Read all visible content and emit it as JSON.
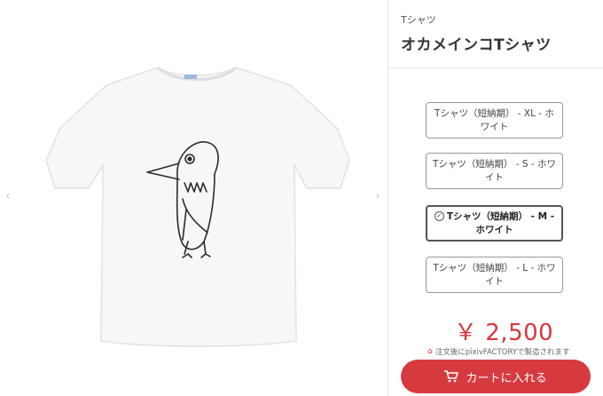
{
  "product": {
    "category": "Tシャツ",
    "title": "オカメインコTシャツ"
  },
  "variants": [
    {
      "label": "Tシャツ（短納期） - XL - ホワイト",
      "selected": false
    },
    {
      "label": "Tシャツ（短納期） - S - ホワイト",
      "selected": false
    },
    {
      "label": "Tシャツ（短納期） - M - ホワイト",
      "selected": true
    },
    {
      "label": "Tシャツ（短納期） - L - ホワイト",
      "selected": false
    }
  ],
  "price": "￥ 2,500",
  "note": "注文後にpixivFACTORYで製造されます",
  "cart_button": "カートに入れる",
  "gallery": {
    "prev_icon": "chevron-left-icon",
    "next_icon": "chevron-right-icon"
  },
  "colors": {
    "accent": "#d63a3f",
    "price": "#d6373d"
  }
}
